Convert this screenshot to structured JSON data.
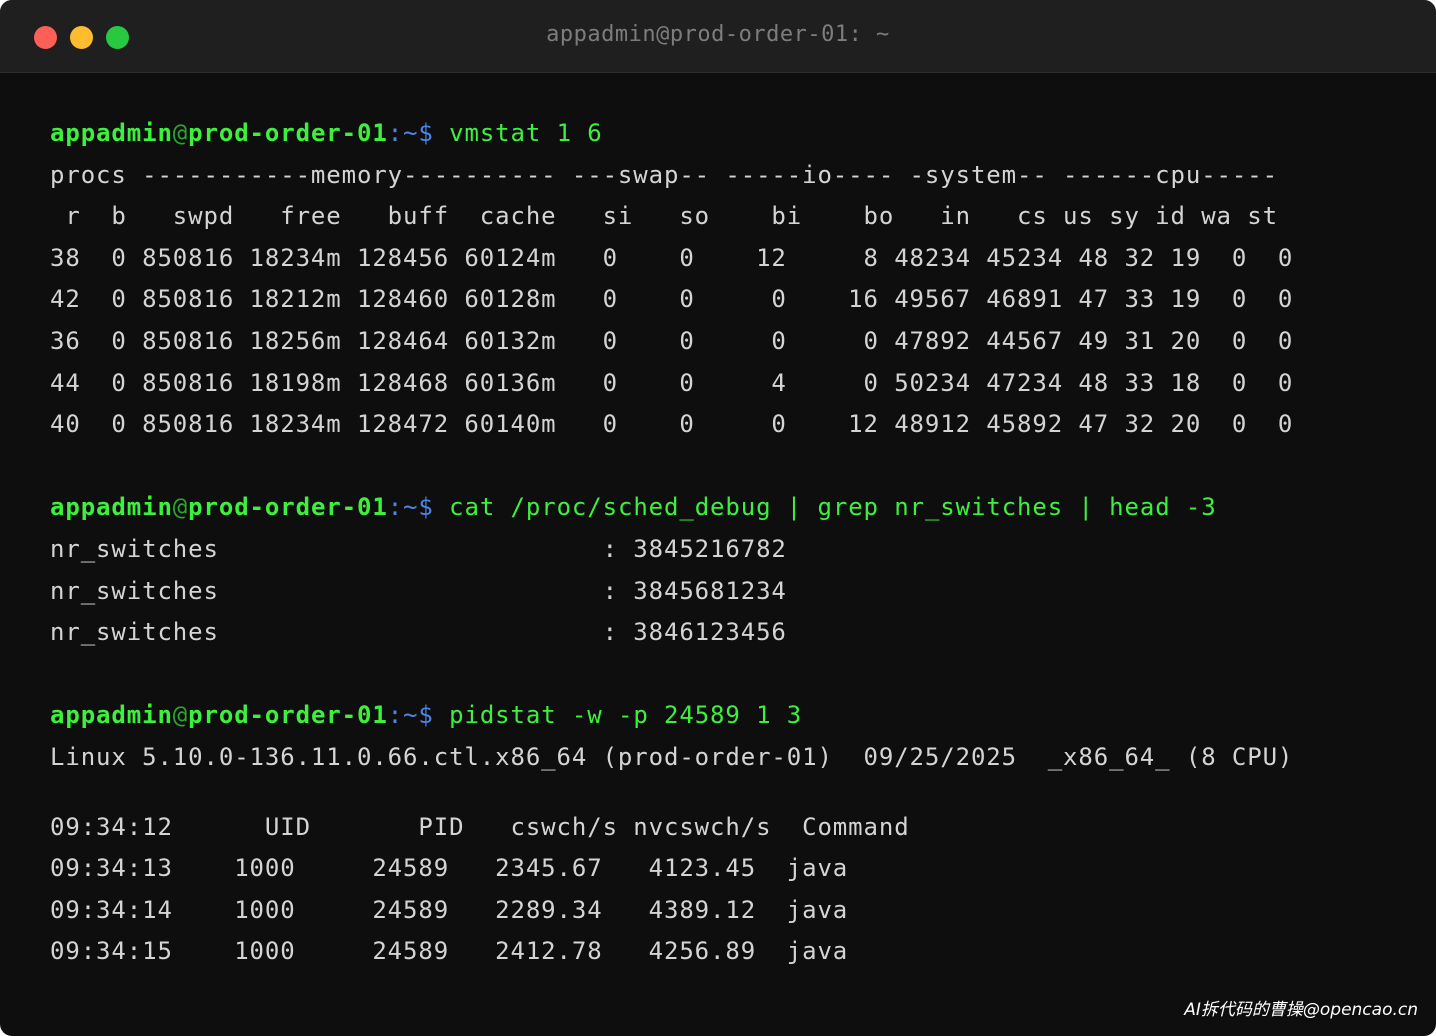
{
  "window": {
    "title": "appadmin@prod-order-01: ~",
    "colors": {
      "close": "#fe5f57",
      "minimize": "#febc2e",
      "maximize": "#28c840"
    }
  },
  "theme": {
    "background": "#0e0e0e",
    "prompt_color": "#3ef03e",
    "path_color": "#4a86e8",
    "output_color": "#d4d4d4"
  },
  "prompt": {
    "user": "appadmin",
    "at": "@",
    "host": "prod-order-01",
    "path": ":~$"
  },
  "commands": {
    "vmstat": {
      "cmd": "vmstat 1 6",
      "lines": [
        "procs -----------memory---------- ---swap-- -----io---- -system-- ------cpu-----",
        " r  b   swpd   free   buff  cache   si   so    bi    bo   in   cs us sy id wa st",
        "38  0 850816 18234m 128456 60124m   0    0    12     8 48234 45234 48 32 19  0  0",
        "42  0 850816 18212m 128460 60128m   0    0     0    16 49567 46891 47 33 19  0  0",
        "36  0 850816 18256m 128464 60132m   0    0     0     0 47892 44567 49 31 20  0  0",
        "44  0 850816 18198m 128468 60136m   0    0     4     0 50234 47234 48 33 18  0  0",
        "40  0 850816 18234m 128472 60140m   0    0     0    12 48912 45892 47 32 20  0  0"
      ]
    },
    "sched": {
      "cmd": "cat /proc/sched_debug | grep nr_switches | head -3",
      "lines": [
        "nr_switches                         : 3845216782",
        "nr_switches                         : 3845681234",
        "nr_switches                         : 3846123456"
      ]
    },
    "pidstat": {
      "cmd": "pidstat -w -p 24589 1 3",
      "header": "Linux 5.10.0-136.11.0.66.ctl.x86_64 (prod-order-01)  09/25/2025  _x86_64_ (8 CPU)",
      "lines": [
        "09:34:12      UID       PID   cswch/s nvcswch/s  Command",
        "09:34:13    1000     24589   2345.67   4123.45  java",
        "09:34:14    1000     24589   2289.34   4389.12  java",
        "09:34:15    1000     24589   2412.78   4256.89  java"
      ]
    }
  },
  "watermark": "AI拆代码的曹操@opencao.cn"
}
